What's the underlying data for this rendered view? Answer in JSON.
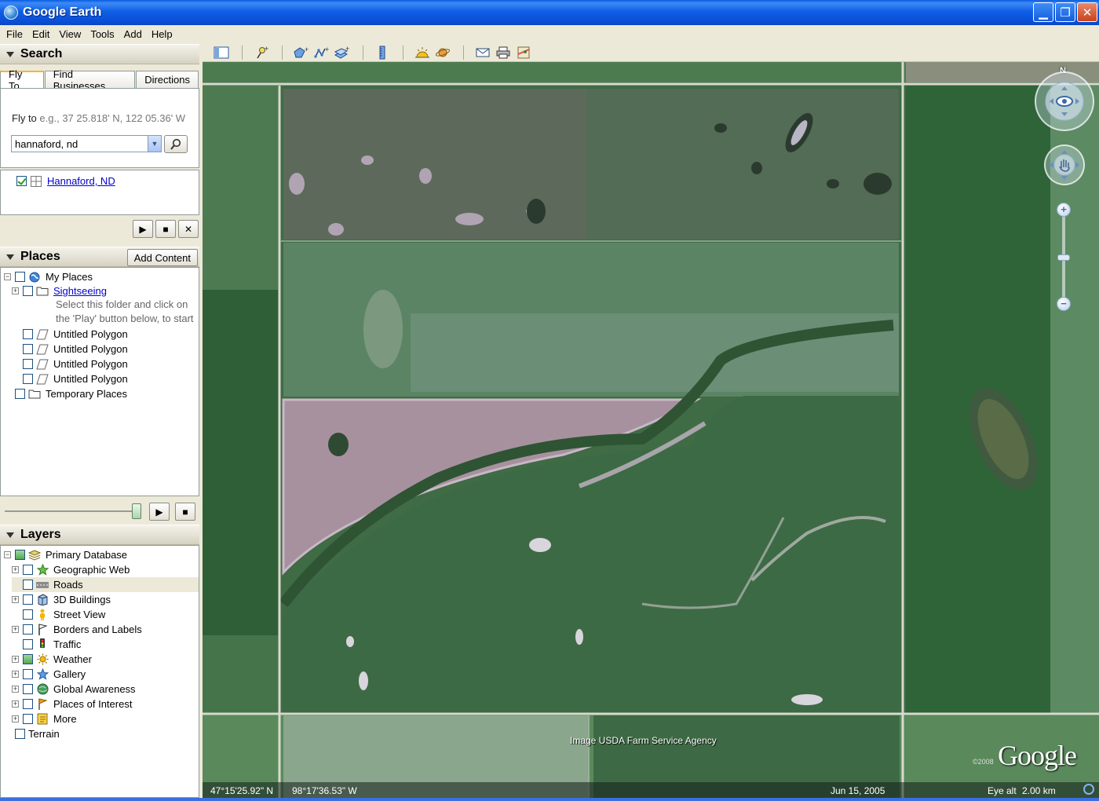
{
  "window": {
    "title": "Google Earth"
  },
  "menu": [
    "File",
    "Edit",
    "View",
    "Tools",
    "Add",
    "Help"
  ],
  "search": {
    "header": "Search",
    "tabs": [
      "Fly To",
      "Find Businesses",
      "Directions"
    ],
    "fly_to_label": "Fly to",
    "fly_to_hint": "e.g., 37 25.818' N, 122 05.36' W",
    "input_value": "hannaford, nd",
    "result": "Hannaford, ND"
  },
  "places": {
    "header": "Places",
    "add_content": "Add Content",
    "items": [
      {
        "label": "My Places"
      },
      {
        "label": "Sightseeing"
      },
      {
        "label": "Untitled Polygon"
      },
      {
        "label": "Untitled Polygon"
      },
      {
        "label": "Untitled Polygon"
      },
      {
        "label": "Untitled Polygon"
      },
      {
        "label": "Temporary Places"
      }
    ],
    "sightseeing_desc_1": "Select this folder and click on",
    "sightseeing_desc_2": "the 'Play' button below, to start"
  },
  "layers": {
    "header": "Layers",
    "items": [
      {
        "label": "Primary Database"
      },
      {
        "label": "Geographic Web"
      },
      {
        "label": "Roads"
      },
      {
        "label": "3D Buildings"
      },
      {
        "label": "Street View"
      },
      {
        "label": "Borders and Labels"
      },
      {
        "label": "Traffic"
      },
      {
        "label": "Weather"
      },
      {
        "label": "Gallery"
      },
      {
        "label": "Global Awareness"
      },
      {
        "label": "Places of Interest"
      },
      {
        "label": "More"
      },
      {
        "label": "Terrain"
      }
    ]
  },
  "map": {
    "attribution": "Image USDA Farm Service Agency",
    "copyright": "©2008",
    "logo": "Google",
    "compass_north": "N",
    "status": {
      "lat": "47°15'25.92\" N",
      "lon": "98°17'36.53\" W",
      "date": "Jun 15, 2005",
      "eye_alt_label": "Eye alt",
      "eye_alt_value": "2.00 km"
    }
  }
}
